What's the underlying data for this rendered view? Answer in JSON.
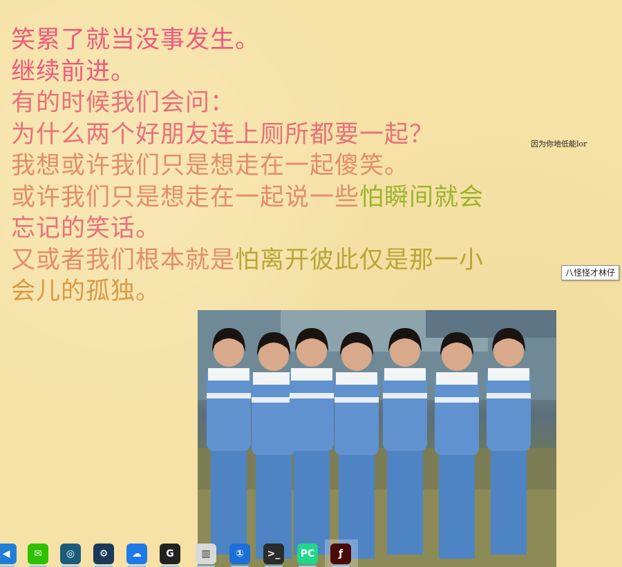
{
  "poem": {
    "lines": [
      {
        "segments": [
          {
            "text": "笑累了就当没事发生。",
            "color": "c-pink"
          }
        ]
      },
      {
        "segments": [
          {
            "text": "继续前进。",
            "color": "c-pink"
          }
        ]
      },
      {
        "segments": [
          {
            "text": "有的时候我们会问：",
            "color": "c-salmon"
          }
        ]
      },
      {
        "segments": [
          {
            "text": "为什么两个好朋友连上厕所都要一起？",
            "color": "c-salmon"
          }
        ]
      },
      {
        "segments": [
          {
            "text": "我想或许我们只是想走在一起傻笑。",
            "color": "c-peach"
          }
        ]
      },
      {
        "segments": [
          {
            "text": "或许我们只是想走在一起说一些",
            "color": "c-peach"
          },
          {
            "text": "怕瞬间就会",
            "color": "c-green"
          }
        ]
      },
      {
        "segments": [
          {
            "text": "忘记的笑话。",
            "color": "c-salmon"
          }
        ]
      },
      {
        "segments": [
          {
            "text": "又或者我们根本就是",
            "color": "c-peach"
          },
          {
            "text": "怕离开彼此仅是那一小",
            "color": "c-olive"
          }
        ]
      },
      {
        "segments": [
          {
            "text": "会儿的孤独。",
            "color": "c-orange"
          }
        ]
      }
    ]
  },
  "annotation_small": "因为你地低能lor",
  "tooltip": "八怪怪才林仔",
  "photo": {
    "description_icon": "group-photo"
  },
  "taskbar": {
    "icons": [
      {
        "name": "back-arrow-icon",
        "glyph": "◀",
        "bg": "#1f7fd6"
      },
      {
        "name": "wechat-icon",
        "glyph": "✉",
        "bg": "#2dc100"
      },
      {
        "name": "browser-icon",
        "glyph": "◎",
        "bg": "#1a5d7a"
      },
      {
        "name": "steam-icon",
        "glyph": "⚙",
        "bg": "#1b3a5a"
      },
      {
        "name": "cloud-drive-icon",
        "glyph": "☁",
        "bg": "#1e7ae8"
      },
      {
        "name": "logitech-icon",
        "glyph": "G",
        "bg": "#222222"
      },
      {
        "name": "monitor-icon",
        "glyph": "▥",
        "bg": "#d9d9d9"
      },
      {
        "name": "password-manager-icon",
        "glyph": "①",
        "bg": "#1a6fd8"
      },
      {
        "name": "terminal-icon",
        "glyph": ">_",
        "bg": "#2b2b2b"
      },
      {
        "name": "pycharm-icon",
        "glyph": "PC",
        "bg": "#21d789"
      },
      {
        "name": "flash-icon",
        "glyph": "ƒ",
        "bg": "#4a0a0a"
      }
    ]
  }
}
